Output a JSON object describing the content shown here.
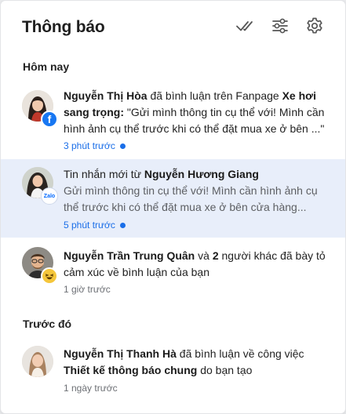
{
  "header": {
    "title": "Thông báo",
    "icons": [
      "mark-all-read-icon",
      "filter-sliders-icon",
      "settings-gear-icon"
    ]
  },
  "sections": {
    "today": "Hôm nay",
    "earlier": "Trước đó"
  },
  "notifications": [
    {
      "actor": "Nguyễn Thị Hòa",
      "action": " đã bình luận trên Fanpage ",
      "target": "Xe hơi sang trọng:",
      "message": " \"Gửi mình thông tin cụ thể với! Mình cần hình ảnh cụ thể trước khi có thể đặt mua xe ở bên ...\"",
      "time": "3 phút trước",
      "unread": true,
      "source_icon": "facebook-icon"
    },
    {
      "prefix": "Tin nhắn mới từ ",
      "actor": "Nguyễn Hương Giang",
      "message": "Gửi mình thông tin cụ thể với! Mình cần hình ảnh cụ thể trước khi có thể đặt mua xe ở bên cửa hàng...",
      "time": "5 phút trước",
      "unread": true,
      "source_icon": "zalo-icon",
      "source_label": "Zalo"
    },
    {
      "actor": "Nguyễn Trần Trung Quân",
      "join": " và ",
      "count": "2",
      "action": " người khác đã bày tỏ cảm xúc về bình luận của bạn",
      "time": "1 giờ trước",
      "unread": false,
      "source_icon": "laughing-emoji-icon"
    },
    {
      "actor": "Nguyễn Thị Thanh Hà",
      "action": " đã bình luận về công việc ",
      "target": "Thiết kế thông báo chung",
      "suffix": " do bạn tạo",
      "time": "1 ngày trước",
      "unread": false
    }
  ],
  "colors": {
    "accent": "#1a6ee8",
    "highlight_bg": "#e8eefa",
    "facebook": "#1877f2",
    "zalo": "#0068ff"
  }
}
